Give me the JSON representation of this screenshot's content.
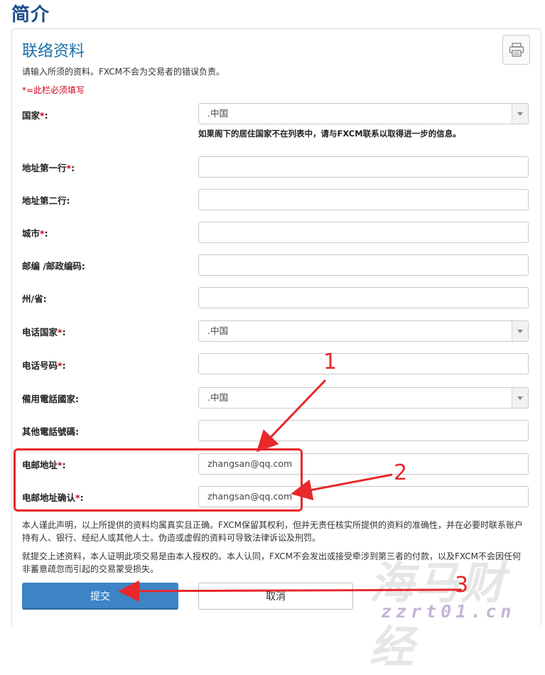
{
  "page": {
    "title": "简介"
  },
  "section": {
    "title": "联络资料",
    "intro": "请输入所须的资料。FXCM不会为交易者的错误负责。",
    "required_note": "*=此栏必须填写",
    "print_icon": "printer-icon"
  },
  "fields": [
    {
      "label": "国家",
      "required": "*",
      "suffix": ":",
      "type": "select",
      "value": ".中国"
    },
    {
      "label": "地址第一行",
      "required": "*",
      "suffix": ":",
      "type": "text",
      "value": ""
    },
    {
      "label": "地址第二行",
      "required": "",
      "suffix": ":",
      "type": "text",
      "value": ""
    },
    {
      "label": "城市",
      "required": "*",
      "suffix": ":",
      "type": "text",
      "value": ""
    },
    {
      "label": "邮编 /邮政编码",
      "required": "",
      "suffix": ":",
      "type": "text",
      "value": ""
    },
    {
      "label": "州/省",
      "required": "",
      "suffix": ":",
      "type": "text",
      "value": ""
    },
    {
      "label": "电话国家",
      "required": "*",
      "suffix": ":",
      "type": "select",
      "value": ".中国"
    },
    {
      "label": "电话号码",
      "required": "*",
      "suffix": ":",
      "type": "text",
      "value": ""
    },
    {
      "label": "備用電話國家",
      "required": "",
      "suffix": ":",
      "type": "select",
      "value": ".中国"
    },
    {
      "label": "其他電話號碼",
      "required": "",
      "suffix": ":",
      "type": "text",
      "value": ""
    },
    {
      "label": "电邮地址",
      "required": "*",
      "suffix": ":",
      "type": "text",
      "value": "zhangsan@qq.com"
    },
    {
      "label": "电邮地址确认",
      "required": "*",
      "suffix": ":",
      "type": "text",
      "value": "zhangsan@qq.com"
    }
  ],
  "country_hint": "如果阁下的居住国家不在列表中，请与FXCM联系以取得进一步的信息。",
  "disclaimer_1": "本人谨此声明，以上所提供的资料均属真实且正确。FXCM保留其权利，但并无责任核实所提供的资料的准确性，并在必要时联系账户持有人、银行、经纪人或其他人士。伪造或虚假的资料可导致法律诉讼及刑罚。",
  "disclaimer_2": "就提交上述资料，本人证明此项交易是由本人授权的。本人认同，FXCM不会发出或接受牵涉到第三者的付款，以及FXCM不会因任何非蓄意疏忽而引起的交易蒙受损失。",
  "buttons": {
    "submit": "提交",
    "cancel": "取消"
  },
  "annotations": {
    "n1": "1",
    "n2": "2",
    "n3": "3",
    "color": "#e8282b"
  },
  "watermark": {
    "line1": "海马财经",
    "line2": "zzrt01.cn"
  }
}
